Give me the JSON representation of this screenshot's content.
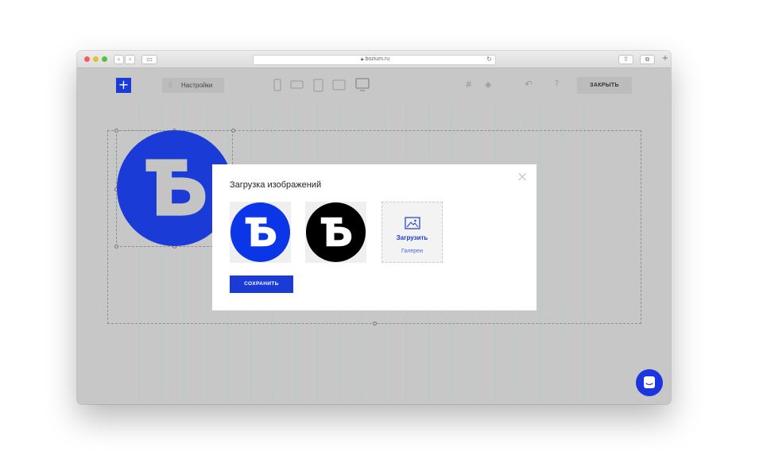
{
  "browser": {
    "url": "bozium.ru",
    "lock_icon": "lock-icon",
    "traffic_lights": {
      "close": "#fc5b57",
      "minimize": "#e5bf3c",
      "maximize": "#57c038"
    }
  },
  "editor": {
    "add_button_label": "+",
    "settings_label": "Настройки",
    "close_label": "ЗАКРЫТЬ",
    "help_label": "?",
    "logo_letter": "Ƃ",
    "accent": "#1a3bd6"
  },
  "modal": {
    "title": "Загрузка изображений",
    "close_icon": "close-icon",
    "images": [
      {
        "name": "logo-blue",
        "bg": "#0b36e8",
        "letter": "Ƃ"
      },
      {
        "name": "logo-black",
        "bg": "#000000",
        "letter": "Ƃ"
      }
    ],
    "upload_label": "Загрузить",
    "gallery_label": "Галереи",
    "save_label": "СОХРАНИТЬ"
  }
}
